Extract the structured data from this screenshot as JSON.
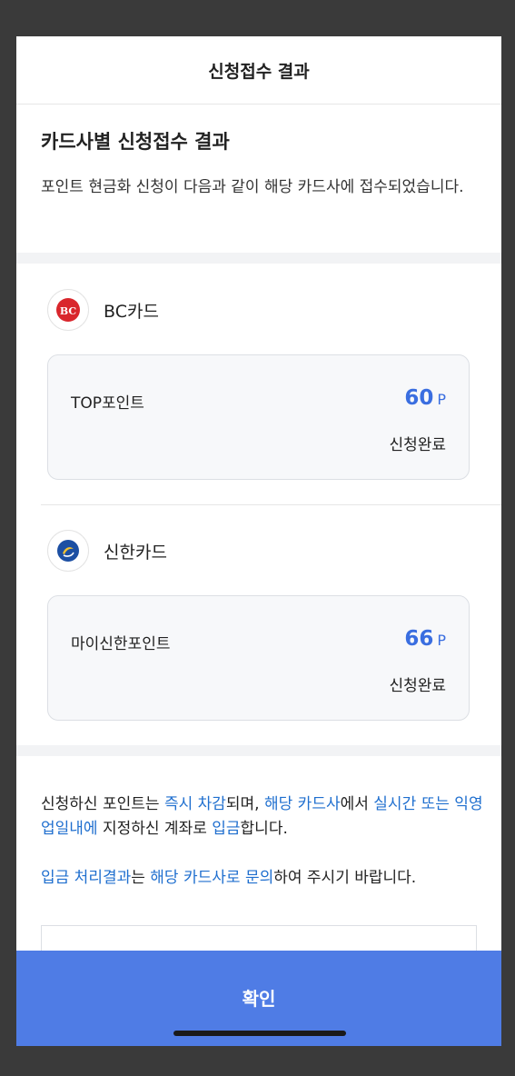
{
  "header": {
    "title": "신청접수 결과"
  },
  "section": {
    "title": "카드사별 신청접수 결과",
    "description": "포인트 현금화 신청이 다음과 같이 해당 카드사에 접수되었습니다."
  },
  "cards": [
    {
      "name": "BC카드",
      "logo": "bc-card-logo-icon",
      "logo_color": "#d9262c",
      "point_name": "TOP포인트",
      "amount": "60",
      "unit": "P",
      "status": "신청완료"
    },
    {
      "name": "신한카드",
      "logo": "shinhan-card-logo-icon",
      "logo_color": "#1c4fa3",
      "point_name": "마이신한포인트",
      "amount": "66",
      "unit": "P",
      "status": "신청완료"
    }
  ],
  "notice": {
    "line1": [
      {
        "t": "신청하신 포인트는 ",
        "hl": false
      },
      {
        "t": "즉시 차감",
        "hl": true
      },
      {
        "t": "되며, ",
        "hl": false
      },
      {
        "t": "해당 카드사",
        "hl": true
      },
      {
        "t": "에서 ",
        "hl": false
      },
      {
        "t": "실시간 또는 익영업일내에",
        "hl": true
      },
      {
        "t": " 지정하신 계좌로 ",
        "hl": false
      },
      {
        "t": "입금",
        "hl": true
      },
      {
        "t": "합니다.",
        "hl": false
      }
    ],
    "line2": [
      {
        "t": "입금 처리결과",
        "hl": true
      },
      {
        "t": "는 ",
        "hl": false
      },
      {
        "t": "해당 카드사로 문의",
        "hl": true
      },
      {
        "t": "하여 주시기 바랍니다.",
        "hl": false
      }
    ]
  },
  "confirm_button": {
    "label": "확인"
  },
  "colors": {
    "accent": "#4f7ce5",
    "link": "#1f6fcf",
    "amount": "#3a6ee0"
  }
}
